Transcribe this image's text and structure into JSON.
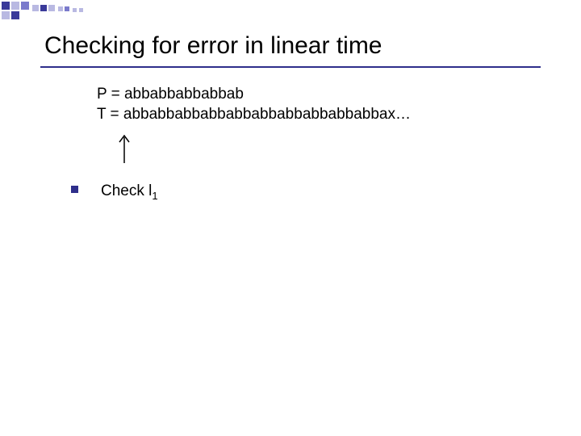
{
  "title": "Checking for error in linear time",
  "p_line": "P = abbabbabbabbab",
  "t_line": "T = abbabbabbabbabbabbabbabbabbabbax…",
  "bullet": {
    "check_prefix": "Check l",
    "check_sub": "1"
  },
  "colors": {
    "accent": "#2e2e8b"
  }
}
